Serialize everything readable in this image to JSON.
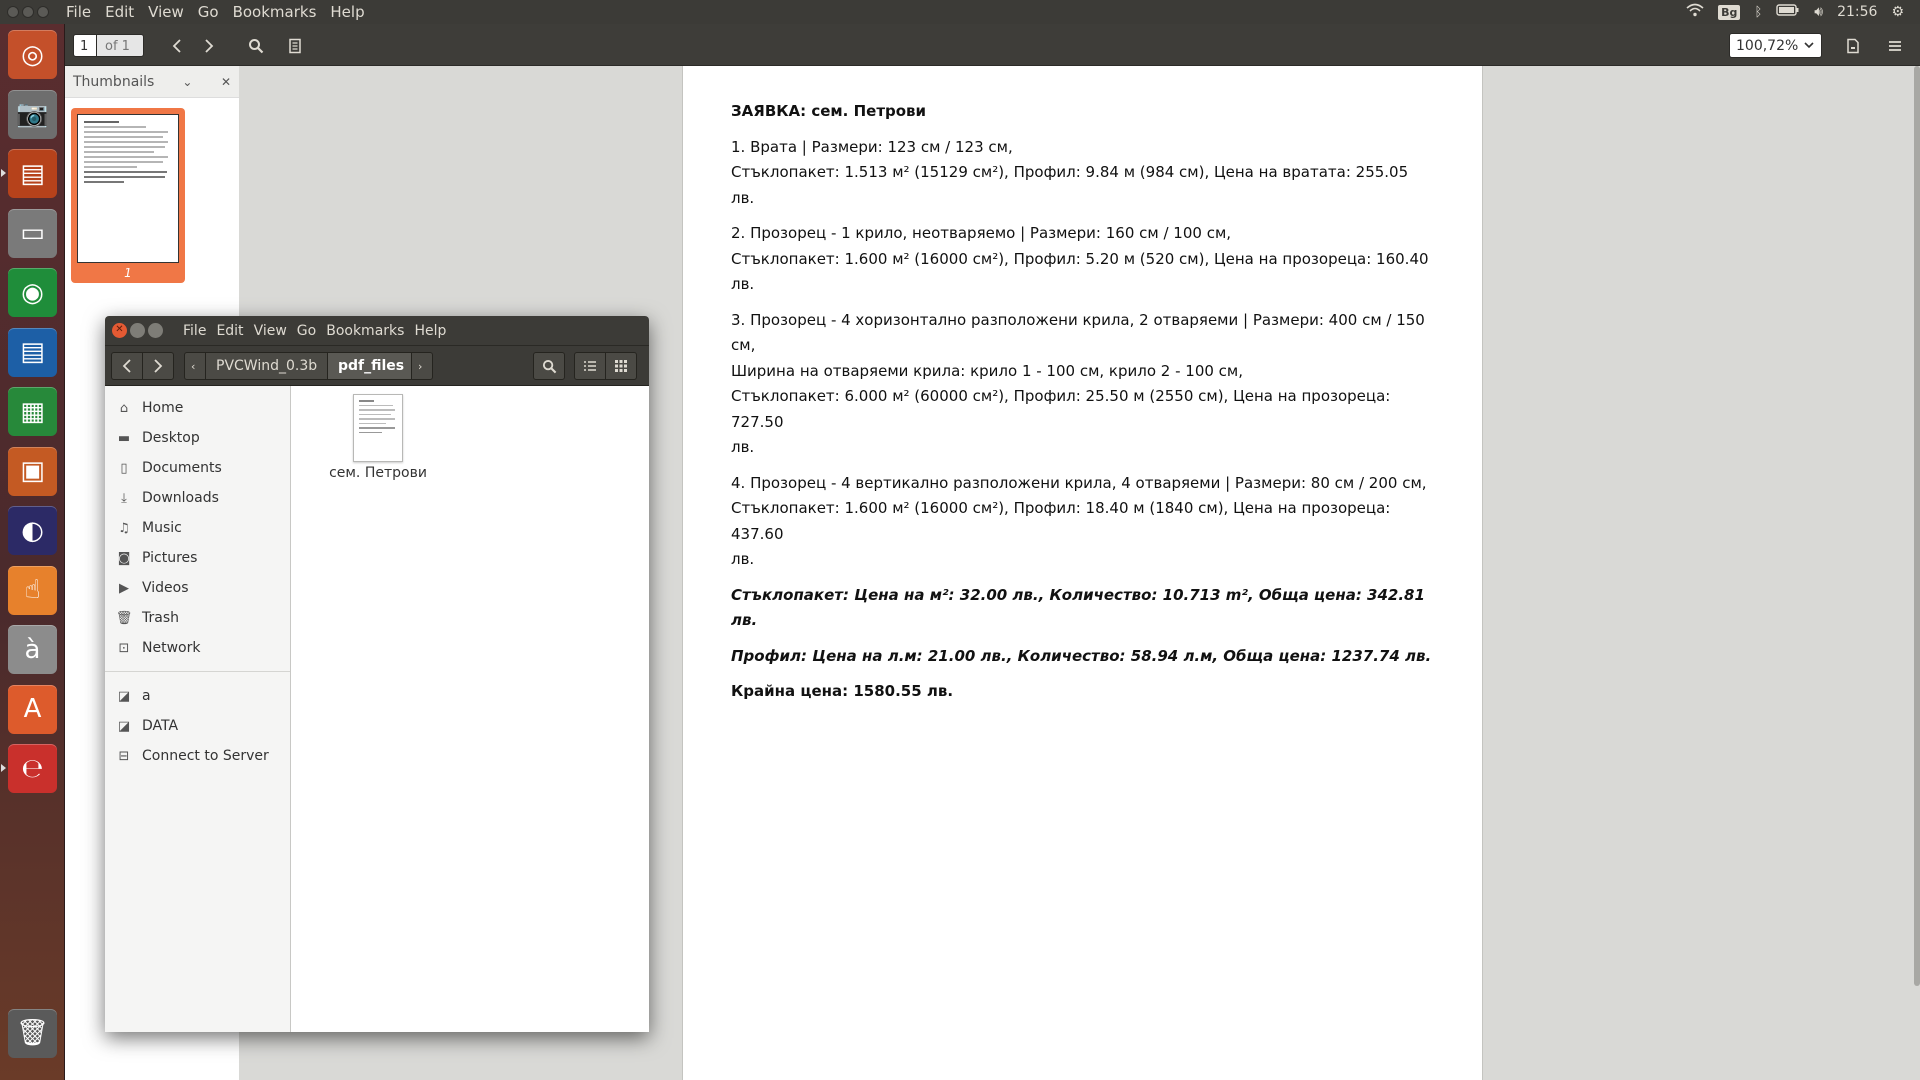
{
  "top_panel": {
    "menu": [
      "File",
      "Edit",
      "View",
      "Go",
      "Bookmarks",
      "Help"
    ],
    "keyboard_layout": "Bg",
    "clock": "21:56"
  },
  "launcher": {
    "items": [
      {
        "name": "ubuntu-dash",
        "glyph": "◎",
        "color": "#c4502a"
      },
      {
        "name": "camera",
        "glyph": "📷",
        "color": "#6e6e6e"
      },
      {
        "name": "file-manager",
        "glyph": "▤",
        "color": "#b6421b"
      },
      {
        "name": "disk-drive",
        "glyph": "▭",
        "color": "#7a7a7a"
      },
      {
        "name": "chrome",
        "glyph": "◉",
        "color": "#1f8d3a"
      },
      {
        "name": "writer",
        "glyph": "▤",
        "color": "#1d5fa6"
      },
      {
        "name": "calc",
        "glyph": "▦",
        "color": "#27893a"
      },
      {
        "name": "impress",
        "glyph": "▣",
        "color": "#c45a23"
      },
      {
        "name": "eclipse",
        "glyph": "◐",
        "color": "#2c2a66"
      },
      {
        "name": "touch-app",
        "glyph": "☝",
        "color": "#e7812c"
      },
      {
        "name": "character-map",
        "glyph": "à",
        "color": "#8c8c8c"
      },
      {
        "name": "software-center",
        "glyph": "A",
        "color": "#dd5b2c"
      },
      {
        "name": "pdf-viewer",
        "glyph": "℮",
        "color": "#c9302c"
      },
      {
        "name": "trash",
        "glyph": "🗑",
        "color": "#5a5a5a"
      }
    ]
  },
  "viewer": {
    "page_current": "1",
    "page_total": "of 1",
    "zoom": "100,72%",
    "sidebar_title": "Thumbnails",
    "thumb_number": "1"
  },
  "document": {
    "title": "ЗАЯВКА: сем. Петрови",
    "items": [
      {
        "l1": "1. Врата | Размери: 123 см / 123 см,",
        "l2": "Стъклопакет: 1.513 м² (15129 см²), Профил: 9.84 м (984 см), Цена на вратата: 255.05 лв.",
        "l3": "",
        "l4": ""
      },
      {
        "l1": "2. Прозорец - 1 крило, неотваряемо | Размери: 160 см / 100 см,",
        "l2": "Стъклопакет: 1.600 м² (16000 см²), Профил: 5.20 м (520 см), Цена на прозореца: 160.40 лв.",
        "l3": "",
        "l4": ""
      },
      {
        "l1": "3. Прозорец - 4 хоризонтално разположени крила, 2 отваряеми | Размери: 400 см / 150 см,",
        "l2": "Ширина на отваряеми крила: крило 1 - 100 см, крило 2 - 100 см,",
        "l3": "Стъклопакет: 6.000 м² (60000 см²), Профил: 25.50 м (2550 см), Цена на прозореца: 727.50",
        "l4": "лв."
      },
      {
        "l1": "4. Прозорец - 4 вертикално разположени крила, 4 отваряеми | Размери: 80 см / 200 см,",
        "l2": "Стъклопакет: 1.600 м² (16000 см²), Профил: 18.40 м (1840 см), Цена на прозореца: 437.60",
        "l3": "лв.",
        "l4": ""
      }
    ],
    "glass_summary": "Стъклопакет: Цена на м²: 32.00 лв., Количество: 10.713 m², Обща цена: 342.81 лв.",
    "profile_summary": "Профил: Цена на л.м: 21.00 лв., Количество: 58.94 л.м, Обща цена: 1237.74 лв.",
    "total": "Крайна цена: 1580.55 лв."
  },
  "files": {
    "menu": [
      "File",
      "Edit",
      "View",
      "Go",
      "Bookmarks",
      "Help"
    ],
    "breadcrumb": [
      "PVCWind_0.3b",
      "pdf_files"
    ],
    "places": [
      {
        "icon": "⌂",
        "label": "Home",
        "name": "home"
      },
      {
        "icon": "▬",
        "label": "Desktop",
        "name": "desktop"
      },
      {
        "icon": "▯",
        "label": "Documents",
        "name": "documents"
      },
      {
        "icon": "⤓",
        "label": "Downloads",
        "name": "downloads"
      },
      {
        "icon": "♫",
        "label": "Music",
        "name": "music"
      },
      {
        "icon": "◙",
        "label": "Pictures",
        "name": "pictures"
      },
      {
        "icon": "▶",
        "label": "Videos",
        "name": "videos"
      },
      {
        "icon": "🗑",
        "label": "Trash",
        "name": "trash"
      },
      {
        "icon": "⊡",
        "label": "Network",
        "name": "network"
      }
    ],
    "devices": [
      {
        "icon": "◪",
        "label": "a",
        "name": "a"
      },
      {
        "icon": "◪",
        "label": "DATA",
        "name": "data"
      },
      {
        "icon": "⊟",
        "label": "Connect to Server",
        "name": "connect-to-server"
      }
    ],
    "file_name": "сем. Петрови"
  }
}
